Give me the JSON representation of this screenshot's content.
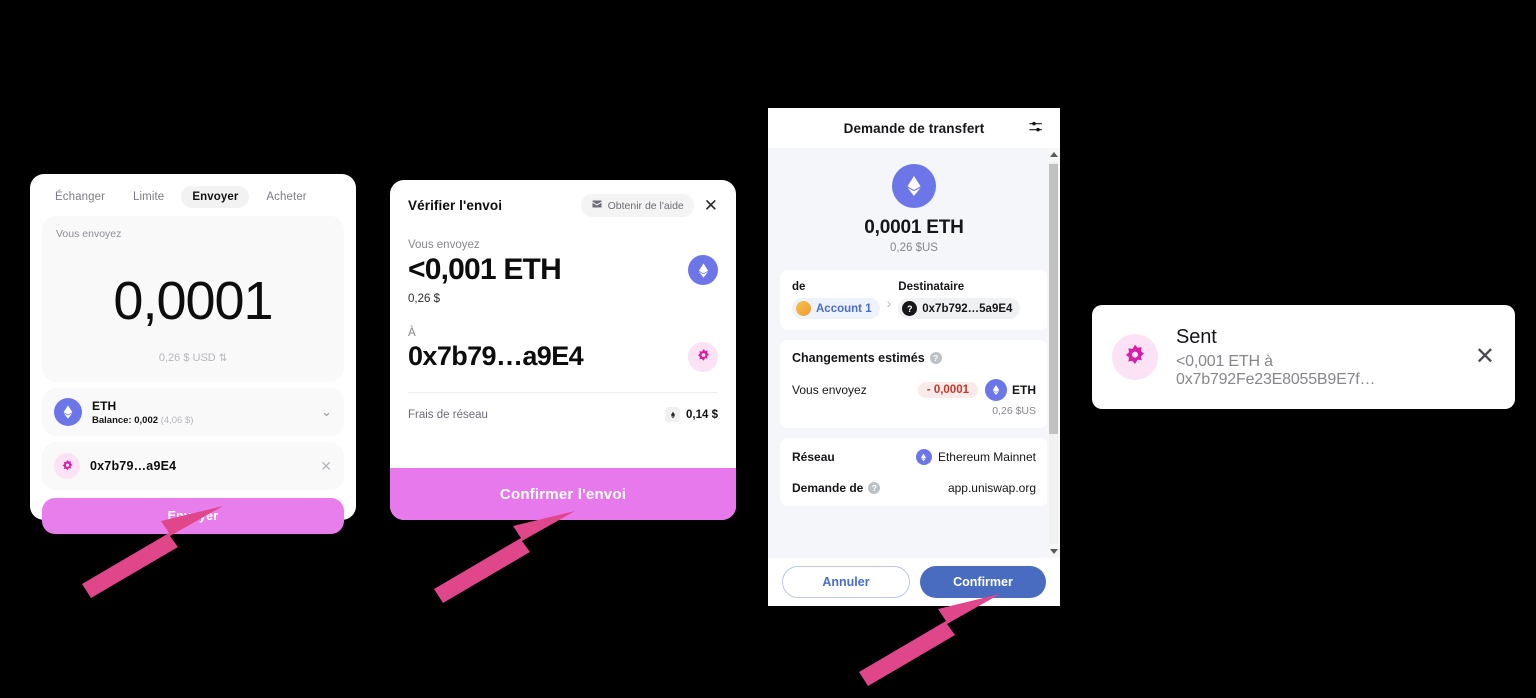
{
  "uniswap": {
    "tabs": [
      {
        "label": "Échanger",
        "active": false
      },
      {
        "label": "Limite",
        "active": false
      },
      {
        "label": "Envoyer",
        "active": true
      },
      {
        "label": "Acheter",
        "active": false
      }
    ],
    "you_send_label": "Vous envoyez",
    "amount": "0,0001",
    "amount_usd": "0,26 $ USD",
    "swap_glyph": "⇅",
    "token": {
      "symbol": "ETH",
      "balance_label": "Balance: 0,002",
      "balance_fiat": "(4,06 $)",
      "chevron": "⌄"
    },
    "recipient": {
      "address": "0x7b79…a9E4",
      "clear_glyph": "✕"
    },
    "send_button": "Envoyer"
  },
  "review": {
    "title": "Vérifier l'envoi",
    "help_label": "Obtenir de l'aide",
    "close_glyph": "✕",
    "you_send_label": "Vous envoyez",
    "amount": "<0,001 ETH",
    "amount_fiat": "0,26 $",
    "to_label": "À",
    "to_address": "0x7b79…a9E4",
    "fee_label": "Frais de réseau",
    "fee_value": "0,14 $",
    "confirm_button": "Confirmer l'envoi"
  },
  "metamask": {
    "title": "Demande de transfert",
    "hero_amount": "0,0001 ETH",
    "hero_fiat": "0,26 $US",
    "from_label": "de",
    "from_account": "Account 1",
    "to_label": "Destinataire",
    "to_address": "0x7b792…5a9E4",
    "arrow_glyph": "›",
    "estimated_changes_title": "Changements estimés",
    "info_glyph": "?",
    "change_row_label": "Vous envoyez",
    "change_amount": "- 0,0001",
    "change_token": "ETH",
    "change_fiat": "0,26 $US",
    "network_label": "Réseau",
    "network_value": "Ethereum Mainnet",
    "request_from_label": "Demande de",
    "request_from_value": "app.uniswap.org",
    "cancel_button": "Annuler",
    "confirm_button": "Confirmer"
  },
  "toast": {
    "title": "Sent",
    "subtitle": "<0,001 ETH à 0x7b792Fe23E8055B9E7f…",
    "close_glyph": "✕"
  },
  "colors": {
    "uniswap_pink": "#e87eec",
    "review_pink": "#e879ed",
    "metamask_blue": "#4a6cc0",
    "eth_purple": "#6d76e8",
    "annotation_pink": "#e0468a",
    "negative_red": "#c0392b"
  }
}
